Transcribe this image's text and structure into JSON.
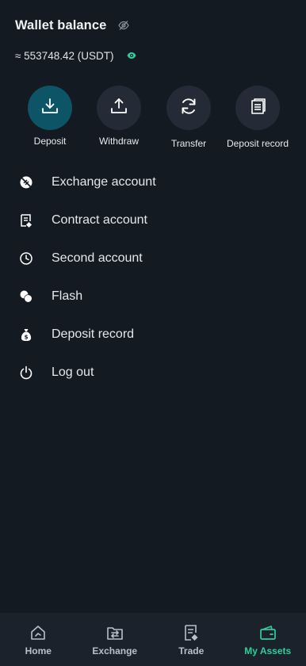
{
  "header": {
    "title": "Wallet balance",
    "balance_text": "≈ 553748.42 (USDT)"
  },
  "colors": {
    "accent": "#2bd09a",
    "primary_button": "#0d5566",
    "background": "#141a22",
    "tabbar": "#1c222c"
  },
  "actions": [
    {
      "label": "Deposit",
      "icon": "download-icon"
    },
    {
      "label": "Withdraw",
      "icon": "upload-icon"
    },
    {
      "label": "Transfer",
      "icon": "refresh-icon"
    },
    {
      "label": "Deposit record",
      "icon": "document-icon"
    }
  ],
  "menu": [
    {
      "label": "Exchange account",
      "icon": "exchange-coin-icon"
    },
    {
      "label": "Contract account",
      "icon": "contract-doc-icon"
    },
    {
      "label": "Second account",
      "icon": "clock-icon"
    },
    {
      "label": "Flash",
      "icon": "flash-coins-icon"
    },
    {
      "label": "Deposit record",
      "icon": "money-bag-icon"
    },
    {
      "label": "Log out",
      "icon": "power-icon"
    }
  ],
  "tabs": [
    {
      "label": "Home",
      "icon": "home-icon",
      "active": false
    },
    {
      "label": "Exchange",
      "icon": "exchange-folder-icon",
      "active": false
    },
    {
      "label": "Trade",
      "icon": "trade-doc-icon",
      "active": false
    },
    {
      "label": "My Assets",
      "icon": "wallet-icon",
      "active": true
    }
  ]
}
